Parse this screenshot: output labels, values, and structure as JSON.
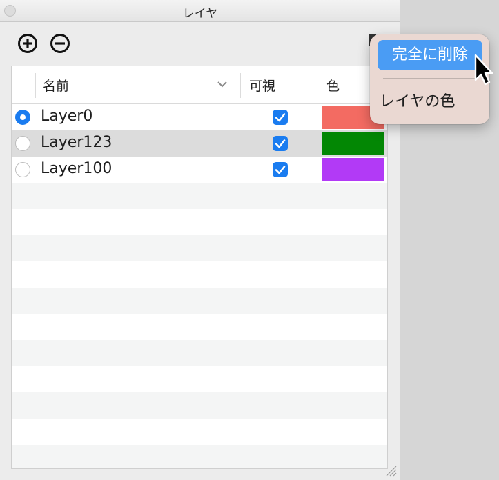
{
  "window": {
    "title": "レイヤ"
  },
  "toolbar": {
    "add_icon": "plus-circle-icon",
    "remove_icon": "minus-circle-icon"
  },
  "table": {
    "columns": {
      "name": "名前",
      "visible": "可視",
      "color": "色"
    },
    "rows": [
      {
        "name": "Layer0",
        "active": true,
        "visible": true,
        "color": "#f36b62"
      },
      {
        "name": "Layer123",
        "active": false,
        "visible": true,
        "color": "#038704"
      },
      {
        "name": "Layer100",
        "active": false,
        "visible": true,
        "color": "#b23af6"
      }
    ]
  },
  "context_menu": {
    "items": [
      {
        "label": "完全に削除",
        "highlighted": true
      },
      {
        "label": "レイヤの色",
        "highlighted": false
      }
    ]
  },
  "colors": {
    "accent": "#1a7cf0",
    "menu_highlight": "#4a9cf4",
    "menu_background": "#ead8d2"
  }
}
